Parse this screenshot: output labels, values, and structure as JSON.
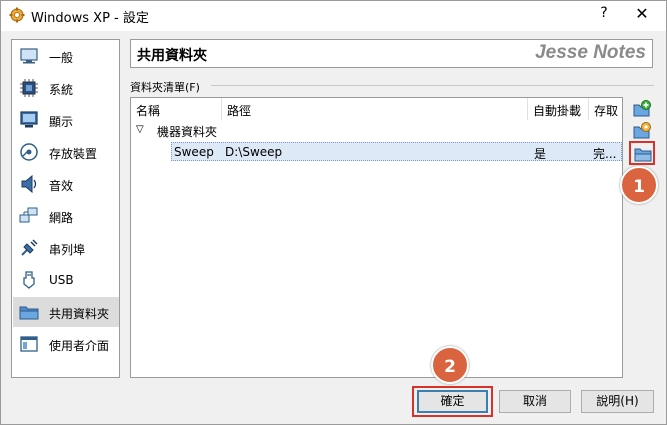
{
  "window": {
    "title": "Windows XP - 設定",
    "help_label": "?",
    "close_label": "✕"
  },
  "sidebar": {
    "items": [
      {
        "label": "一般",
        "icon": "monitor-icon"
      },
      {
        "label": "系統",
        "icon": "chip-icon"
      },
      {
        "label": "顯示",
        "icon": "display-icon"
      },
      {
        "label": "存放裝置",
        "icon": "storage-disk-icon"
      },
      {
        "label": "音效",
        "icon": "speaker-icon"
      },
      {
        "label": "網路",
        "icon": "network-icon"
      },
      {
        "label": "串列埠",
        "icon": "serial-port-icon"
      },
      {
        "label": "USB",
        "icon": "usb-icon"
      },
      {
        "label": "共用資料夾",
        "icon": "folder-icon"
      },
      {
        "label": "使用者介面",
        "icon": "ui-window-icon"
      }
    ],
    "selected_index": 8
  },
  "panel": {
    "title": "共用資料夾",
    "watermark": "Jesse Notes",
    "section_label": "資料夾清單(F)"
  },
  "list": {
    "columns": [
      "名稱",
      "路徑",
      "自動掛載",
      "存取"
    ],
    "group": {
      "arrow": "▽",
      "label": "機器資料夾"
    },
    "rows": [
      {
        "name": "Sweep",
        "path": "D:\\Sweep",
        "automount": "是",
        "access": "完..."
      }
    ]
  },
  "toolbar": {
    "add_icon": "add-folder-icon",
    "edit_icon": "edit-folder-icon",
    "remove_icon": "remove-folder-icon"
  },
  "callouts": {
    "one": "1",
    "two": "2"
  },
  "buttons": {
    "ok": "確定",
    "cancel": "取消",
    "help": "說明(H)"
  },
  "colors": {
    "accent_red": "#d9322b",
    "callout_orange": "#d9643f",
    "selection_blue": "#dde9f7"
  }
}
